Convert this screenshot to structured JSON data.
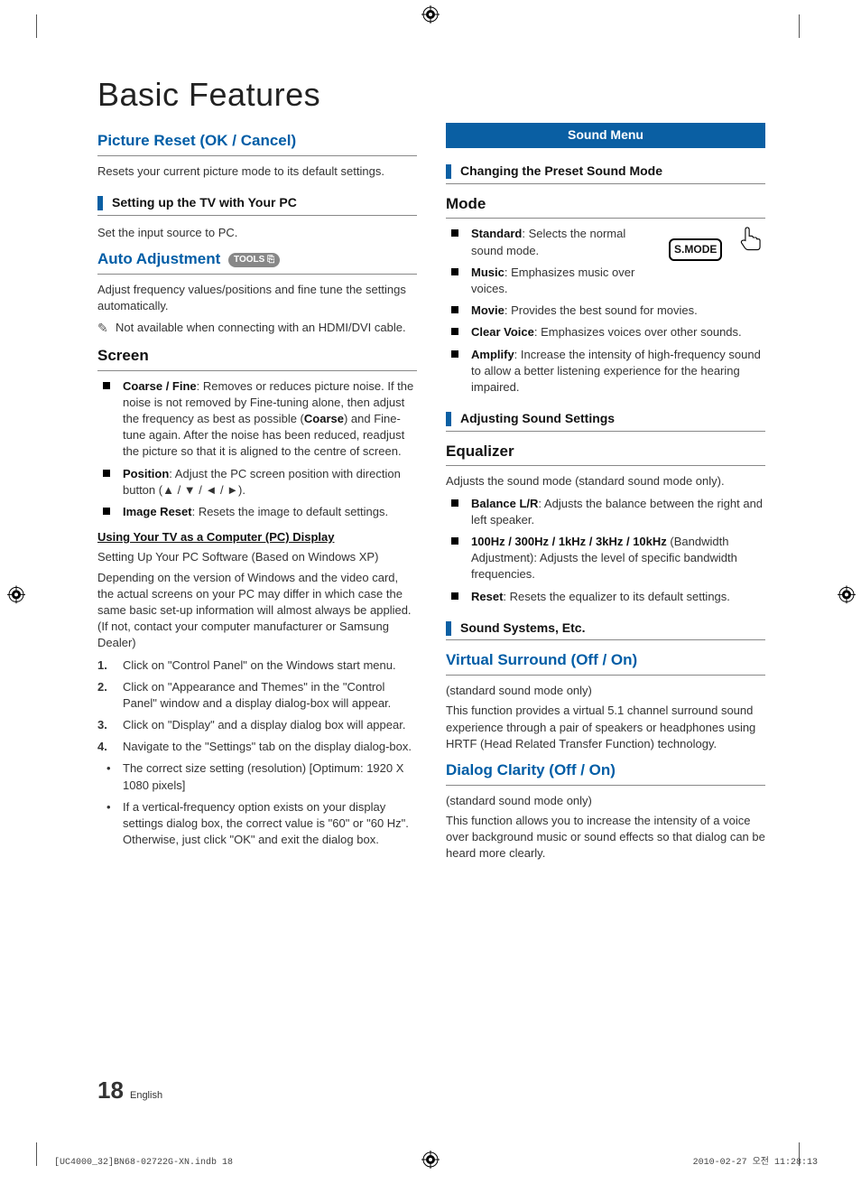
{
  "title": "Basic Features",
  "page_number": "18",
  "page_lang": "English",
  "footer_left": "[UC4000_32]BN68-02722G-XN.indb   18",
  "footer_right": "2010-02-27   오전 11:28:13",
  "left": {
    "picture_reset": {
      "heading": "Picture Reset (OK / Cancel)",
      "desc": "Resets your current picture mode to its default settings."
    },
    "setup_pc": {
      "bar": "Setting up the TV with Your PC",
      "desc": "Set the input source to PC."
    },
    "auto_adj": {
      "heading": "Auto Adjustment",
      "tools": "TOOLS",
      "desc": "Adjust frequency values/positions and fine tune the settings automatically.",
      "note": "Not available when connecting with an HDMI/DVI cable."
    },
    "screen": {
      "heading": "Screen",
      "items": [
        {
          "b": "Coarse / Fine",
          "t": ": Removes or reduces picture noise. If the noise is not removed by Fine-tuning alone, then adjust the frequency as best as possible (",
          "b2": "Coarse",
          "t2": ") and Fine-tune again. After the noise has been reduced, readjust the picture so that it is aligned to the centre of screen."
        },
        {
          "b": "Position",
          "t": ": Adjust the PC screen position with direction button (▲ / ▼ / ◄ / ►)."
        },
        {
          "b": "Image Reset",
          "t": ": Resets the image to default settings."
        }
      ],
      "sub_under": "Using Your TV as a Computer (PC) Display",
      "sub_p1": "Setting Up Your PC Software (Based on Windows XP)",
      "sub_p2": "Depending on the version of Windows and the video card, the actual screens on your PC may differ in which case the same basic set-up information will almost always be applied. (If not, contact your computer manufacturer or Samsung Dealer)",
      "steps": [
        "Click on \"Control Panel\" on the Windows start menu.",
        "Click on \"Appearance and Themes\" in the \"Control Panel\" window and a display dialog-box will appear.",
        "Click on \"Display\" and a display dialog box will appear.",
        "Navigate to the \"Settings\" tab on the display dialog-box."
      ],
      "bullets": [
        "The correct size setting (resolution) [Optimum: 1920 X 1080 pixels]",
        "If a vertical-frequency option exists on your display settings dialog box, the correct value is \"60\" or \"60 Hz\". Otherwise, just click \"OK\" and exit the dialog box."
      ]
    }
  },
  "right": {
    "sound_menu": "Sound Menu",
    "changing": "Changing the Preset Sound Mode",
    "smode_label": "S.MODE",
    "mode": {
      "heading": "Mode",
      "items": [
        {
          "b": "Standard",
          "t": ": Selects the normal sound mode."
        },
        {
          "b": "Music",
          "t": ": Emphasizes music over voices."
        },
        {
          "b": "Movie",
          "t": ": Provides the best sound for movies."
        },
        {
          "b": "Clear Voice",
          "t": ": Emphasizes voices over other sounds."
        },
        {
          "b": "Amplify",
          "t": ": Increase the intensity of high-frequency sound to allow a better listening experience for the hearing impaired."
        }
      ]
    },
    "adjusting": "Adjusting Sound Settings",
    "equalizer": {
      "heading": "Equalizer",
      "desc": "Adjusts the sound mode (standard sound mode only).",
      "items": [
        {
          "b": "Balance L/R",
          "t": ": Adjusts the balance between the right and left speaker."
        },
        {
          "b": "100Hz / 300Hz / 1kHz / 3kHz / 10kHz",
          "t": " (Bandwidth Adjustment): Adjusts the level of specific bandwidth frequencies."
        },
        {
          "b": "Reset",
          "t": ": Resets the equalizer to its default settings."
        }
      ]
    },
    "systems": "Sound Systems, Etc.",
    "vs": {
      "heading": "Virtual Surround (Off / On)",
      "sub": "(standard sound mode only)",
      "desc": "This function provides a virtual 5.1 channel surround sound experience through a pair of speakers or headphones using HRTF (Head Related Transfer Function) technology."
    },
    "dc": {
      "heading": "Dialog Clarity (Off / On)",
      "sub": "(standard sound mode only)",
      "desc": "This function allows you to increase the intensity of a voice over background music or sound effects so that dialog can be heard more clearly."
    }
  }
}
